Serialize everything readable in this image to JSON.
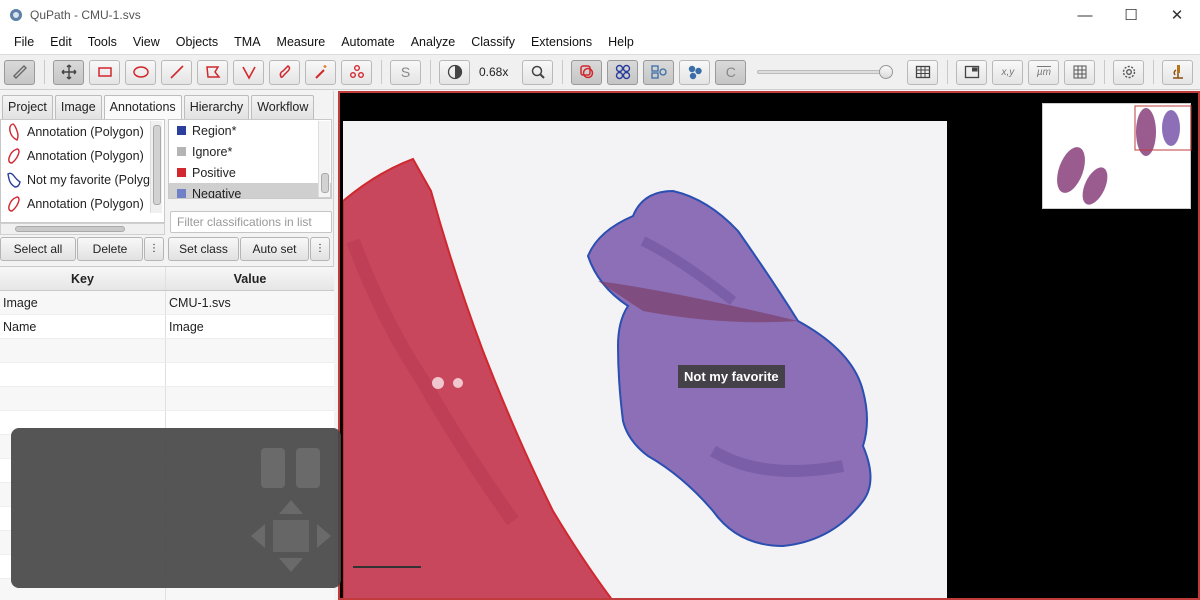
{
  "window": {
    "title": "QuPath - CMU-1.svs",
    "controls": {
      "minimize": "—",
      "maximize": "☐",
      "close": "✕"
    }
  },
  "menu": [
    "File",
    "Edit",
    "Tools",
    "View",
    "Objects",
    "TMA",
    "Measure",
    "Automate",
    "Analyze",
    "Classify",
    "Extensions",
    "Help"
  ],
  "toolbar": {
    "zoom_level": "0.68x",
    "coords_label": "x,y",
    "units_label": "µm",
    "selection_label": "S",
    "contrast_label": "C",
    "tools": [
      "ruler-icon",
      "move-icon",
      "rectangle-icon",
      "ellipse-icon",
      "line-icon",
      "polygon-icon",
      "polyline-icon",
      "brush-icon",
      "wand-icon",
      "points-icon"
    ]
  },
  "left_panel": {
    "tabs": [
      "Project",
      "Image",
      "Annotations",
      "Hierarchy",
      "Workflow"
    ],
    "active_tab": "Annotations",
    "annotations": [
      {
        "label": "Annotation (Polygon)",
        "color": "#d0282e"
      },
      {
        "label": "Annotation (Polygon)",
        "color": "#d0282e"
      },
      {
        "label": "Not my favorite (Polygo",
        "color": "#2a3d9c"
      },
      {
        "label": "Annotation (Polygon)",
        "color": "#d0282e"
      }
    ],
    "classes": [
      {
        "label": "Region*",
        "color": "#2b3f9e"
      },
      {
        "label": "Ignore*",
        "color": "#b4b4b4"
      },
      {
        "label": "Positive",
        "color": "#d0282e"
      },
      {
        "label": "Negative",
        "color": "#6f7fc8"
      }
    ],
    "selected_class": "Negative",
    "filter_placeholder": "Filter classifications in list",
    "buttons": {
      "select_all": "Select all",
      "delete": "Delete",
      "set_class": "Set class",
      "auto_set": "Auto set",
      "more": "⋮"
    },
    "table": {
      "headers": [
        "Key",
        "Value"
      ],
      "rows": [
        [
          "Image",
          "CMU-1.svs"
        ],
        [
          "Name",
          "Image"
        ]
      ]
    }
  },
  "viewer": {
    "annotation_label": "Not my favorite"
  }
}
